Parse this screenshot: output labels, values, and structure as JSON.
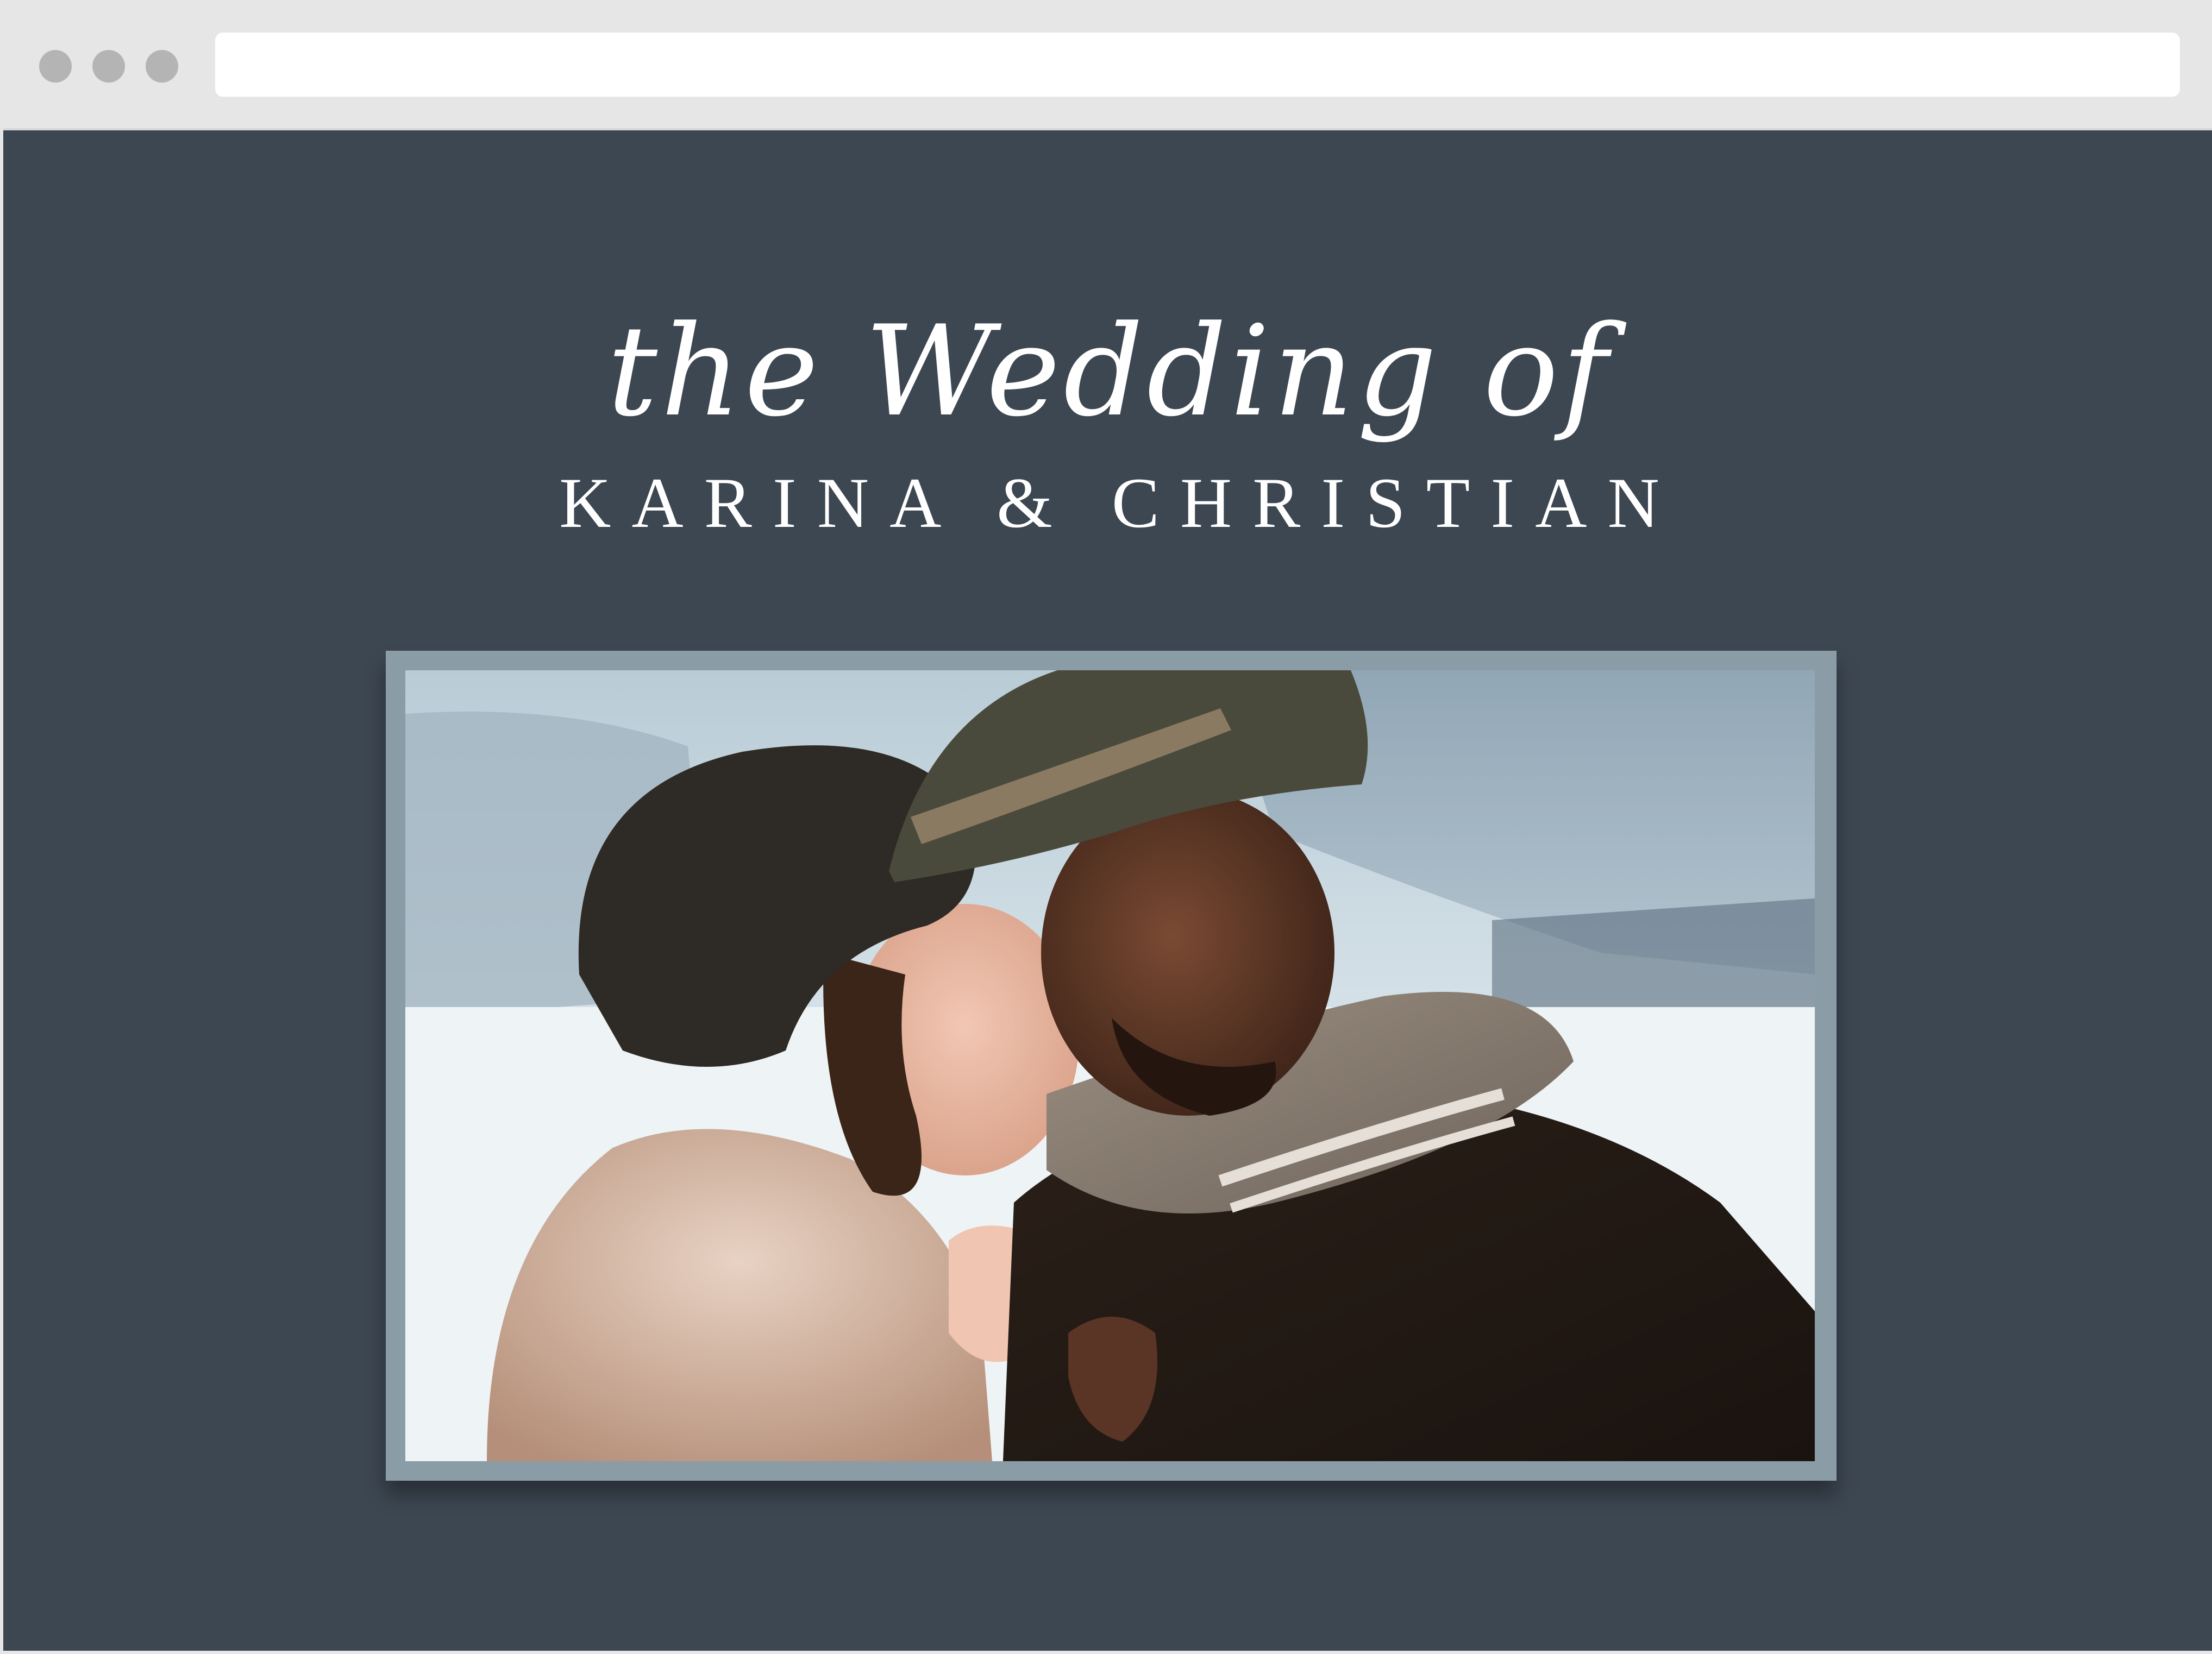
{
  "browser": {
    "url": ""
  },
  "hero": {
    "script_title": "the Wedding of",
    "names": "KARINA & CHRISTIAN"
  },
  "photo": {
    "alt": "Couple in winter coats and hats embracing in a snowy landscape"
  },
  "colors": {
    "page_background": "#3d4752",
    "frame": "#8a9da6",
    "text": "#ffffff",
    "chrome": "#e6e6e6"
  }
}
